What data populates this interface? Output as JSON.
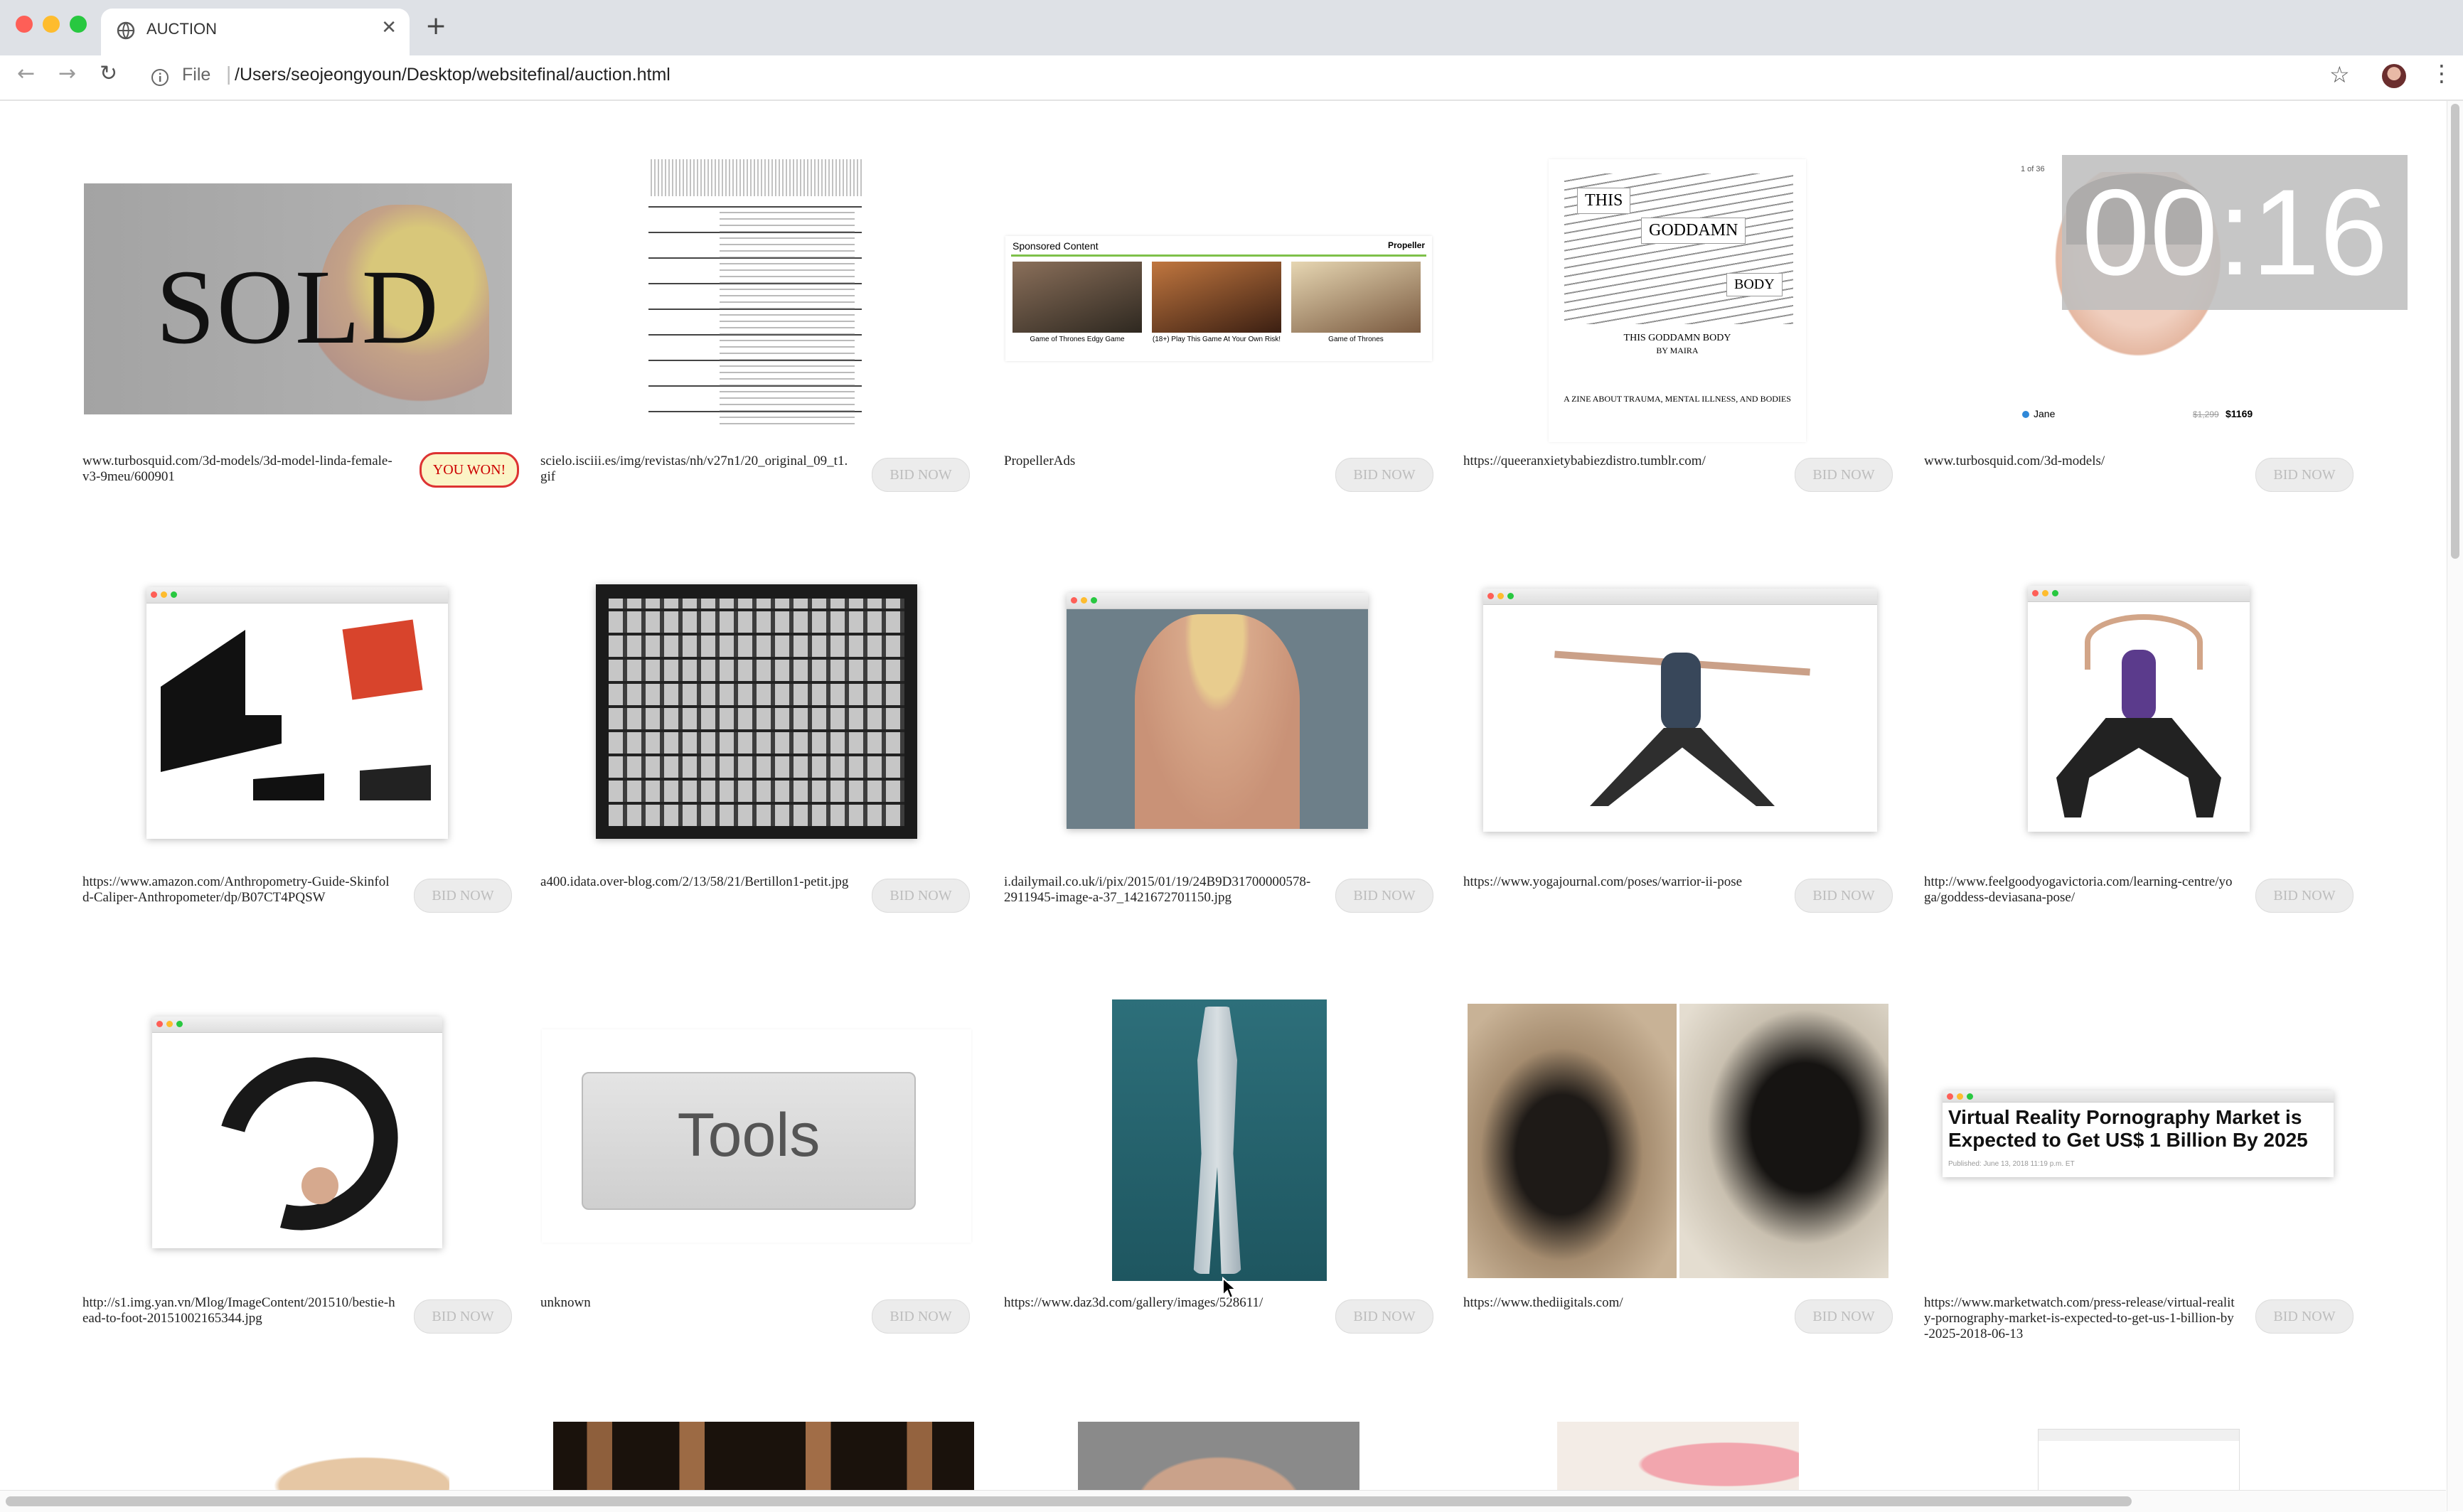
{
  "browser": {
    "tab_title": "AUCTION",
    "url_scheme_label": "File",
    "url": "/Users/seojeongyoun/Desktop/websitefinal/auction.html"
  },
  "timer": "00:16",
  "items": [
    {
      "source": "www.turbosquid.com/3d-models/3d-model-linda-female-v3-9meu/600901",
      "button": "YOU WON!",
      "thumb_text": "SOLD"
    },
    {
      "source": "scielo.isciii.es/img/revistas/nh/v27n1/20_original_09_t1.gif",
      "button": "BID NOW"
    },
    {
      "source": "PropellerAds",
      "button": "BID NOW",
      "thumb_text": "Sponsored Content",
      "thumb_brand": "Propeller",
      "captions": [
        "Game of Thrones Edgy Game",
        "(18+) Play This Game At Your Own Risk!",
        "Game of Thrones"
      ]
    },
    {
      "source": "https://queeranxietybabiezdistro.tumblr.com/",
      "button": "BID NOW",
      "thumb_words": [
        "THIS",
        "GODDAMN",
        "BODY"
      ],
      "thumb_caption": "THIS GODDAMN BODY",
      "thumb_author": "BY MAIRA",
      "thumb_subtitle": "A ZINE ABOUT TRAUMA, MENTAL ILLNESS, AND BODIES"
    },
    {
      "source": "www.turbosquid.com/3d-models/",
      "button": "BID NOW",
      "thumb_count": "1 of 36",
      "thumb_user": "Jane",
      "thumb_old_price": "$1,299",
      "thumb_price": "$1169"
    },
    {
      "source": "https://www.amazon.com/Anthropometry-Guide-Skinfold-Caliper-Anthropometer/dp/B07CT4PQSW",
      "button": "BID NOW"
    },
    {
      "source": "a400.idata.over-blog.com/2/13/58/21/Bertillon1-petit.jpg",
      "button": "BID NOW"
    },
    {
      "source": "i.dailymail.co.uk/i/pix/2015/01/19/24B9D31700000578-2911945-image-a-37_1421672701150.jpg",
      "button": "BID NOW"
    },
    {
      "source": "https://www.yogajournal.com/poses/warrior-ii-pose",
      "button": "BID NOW"
    },
    {
      "source": "http://www.feelgoodyogavictoria.com/learning-centre/yoga/goddess-deviasana-pose/",
      "button": "BID NOW"
    },
    {
      "source": "http://s1.img.yan.vn/Mlog/ImageContent/201510/bestie-head-to-foot-20151002165344.jpg",
      "button": "BID NOW"
    },
    {
      "source": "unknown",
      "button": "BID NOW",
      "thumb_text": "Tools"
    },
    {
      "source": "https://www.daz3d.com/gallery/images/528611/",
      "button": "BID NOW"
    },
    {
      "source": "https://www.thediigitals.com/",
      "button": "BID NOW"
    },
    {
      "source": "https://www.marketwatch.com/press-release/virtual-reality-pornography-market-is-expected-to-get-us-1-billion-by-2025-2018-06-13",
      "button": "BID NOW",
      "thumb_headline": "Virtual Reality Pornography Market is Expected to Get US$ 1 Billion By 2025",
      "thumb_date": "Published: June 13, 2018 11:19 p.m. ET"
    }
  ]
}
